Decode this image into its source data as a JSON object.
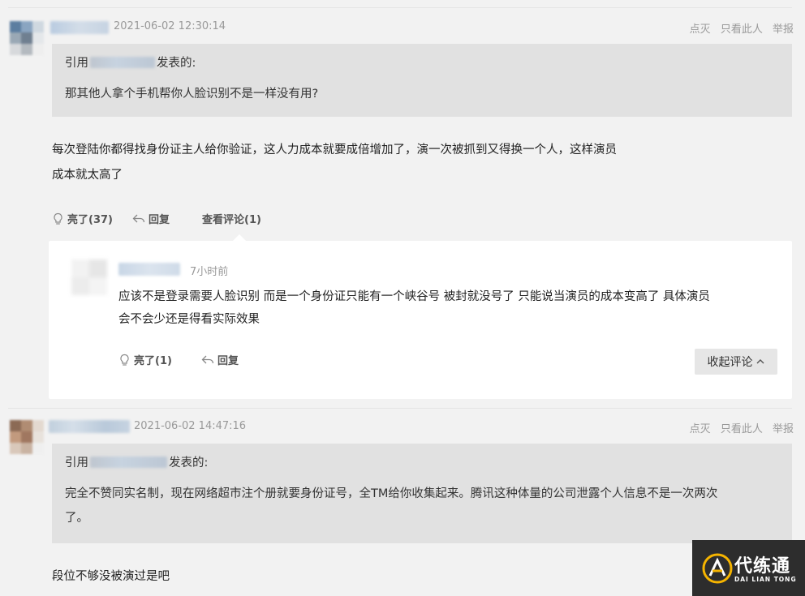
{
  "posts": [
    {
      "timestamp": "2021-06-02 12:30:14",
      "actions": {
        "dislike": "点灭",
        "only_this": "只看此人",
        "report": "举报"
      },
      "quote": {
        "cite_prefix": "引用",
        "cite_suffix": "发表的:",
        "text": "那其他人拿个手机帮你人脸识别不是一样没有用?"
      },
      "body_lines": [
        "每次登陆你都得找身份证主人给你验证，这人力成本就要成倍增加了，演一次被抓到又得换一个人，这样演员",
        "成本就太高了"
      ],
      "bar": {
        "like": "亮了(37)",
        "reply": "回复",
        "view_comments": "查看评论(1)"
      },
      "sub_comment": {
        "time_ago": "7小时前",
        "text_lines": [
          "应该不是登录需要人脸识别 而是一个身份证只能有一个峡谷号 被封就没号了 只能说当演员的成本变高了 具体演员",
          "会不会少还是得看实际效果"
        ],
        "like": "亮了(1)",
        "reply": "回复",
        "collapse": "收起评论"
      }
    },
    {
      "timestamp": "2021-06-02 14:47:16",
      "actions": {
        "dislike": "点灭",
        "only_this": "只看此人",
        "report": "举报"
      },
      "quote": {
        "cite_prefix": "引用",
        "cite_suffix": "发表的:",
        "text_lines": [
          "完全不赞同实名制，现在网络超市注个册就要身份证号，全TM给你收集起来。腾讯这种体量的公司泄露个人信息不是一次两次",
          "了。"
        ]
      },
      "body_lines": [
        "段位不够没被演过是吧"
      ]
    }
  ],
  "logo": {
    "main": "代练通",
    "sub": "DAI LIAN TONG"
  },
  "colors": {
    "quote_bg": "#e1e1e1",
    "page_bg": "#f2f2f2",
    "logo_accent": "#f5b400"
  }
}
